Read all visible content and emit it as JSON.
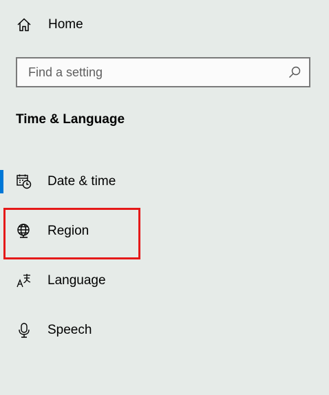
{
  "home": {
    "label": "Home",
    "icon": "home-icon"
  },
  "search": {
    "placeholder": "Find a setting",
    "value": "",
    "icon": "search-icon"
  },
  "section_title": "Time & Language",
  "nav": {
    "items": [
      {
        "label": "Date & time",
        "icon": "calendar-clock-icon",
        "selected": true
      },
      {
        "label": "Region",
        "icon": "globe-icon",
        "selected": false
      },
      {
        "label": "Language",
        "icon": "language-icon",
        "selected": false
      },
      {
        "label": "Speech",
        "icon": "microphone-icon",
        "selected": false
      }
    ]
  },
  "colors": {
    "background": "#e6ebe8",
    "accent": "#0078d7",
    "highlight": "#e51919"
  }
}
